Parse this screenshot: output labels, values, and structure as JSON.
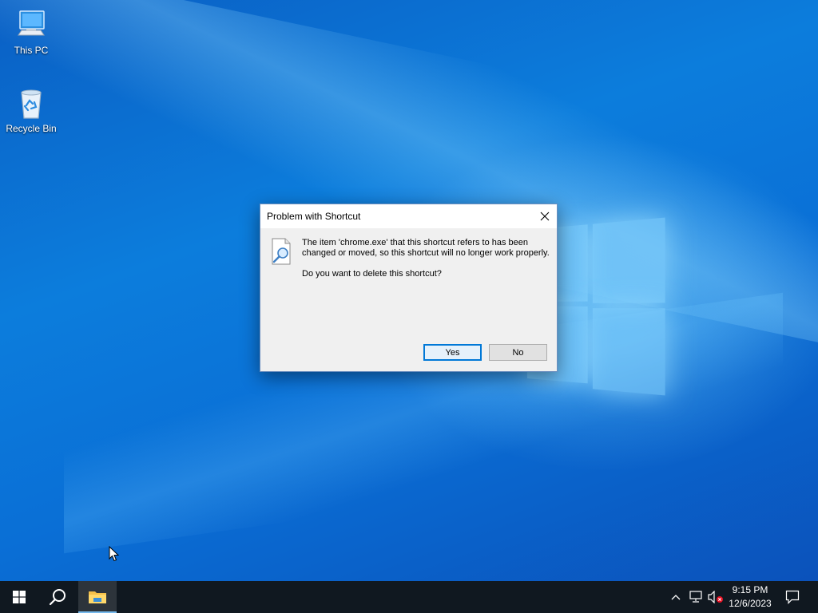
{
  "desktop": {
    "icons": [
      {
        "label": "This PC",
        "icon": "this-pc-icon"
      },
      {
        "label": "Recycle Bin",
        "icon": "recycle-bin-icon"
      }
    ]
  },
  "dialog": {
    "title": "Problem with Shortcut",
    "message": "The item 'chrome.exe' that this shortcut refers to has been changed or moved, so this shortcut will no longer work properly.",
    "question": "Do you want to delete this shortcut?",
    "buttons": {
      "yes": "Yes",
      "no": "No"
    },
    "icon": "broken-shortcut-icon"
  },
  "taskbar": {
    "pinned": [
      {
        "name": "start",
        "icon": "windows-start-icon"
      },
      {
        "name": "search",
        "icon": "search-icon"
      },
      {
        "name": "file-explorer",
        "icon": "folder-icon",
        "active": true
      }
    ],
    "tray": {
      "icons": [
        "chevron-up-icon",
        "network-icon",
        "volume-muted-icon"
      ],
      "time": "9:15 PM",
      "date": "12/6/2023",
      "notification_icon": "action-center-icon"
    }
  },
  "colors": {
    "accent": "#0078d7",
    "taskbar": "#101820"
  }
}
